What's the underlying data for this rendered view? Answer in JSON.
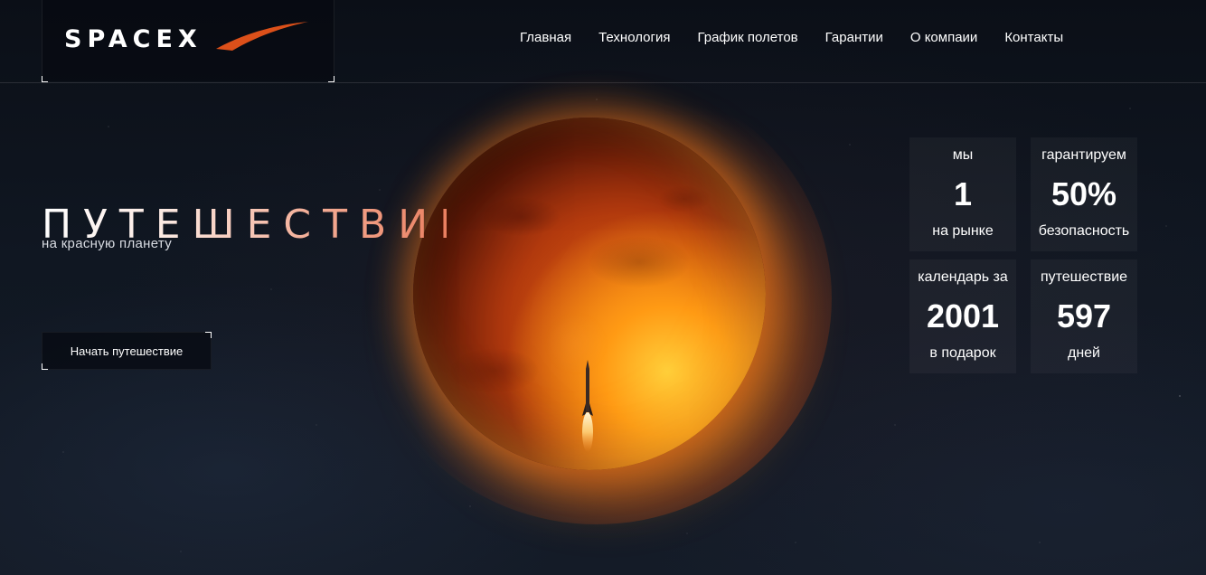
{
  "brand": {
    "logo_text": "SPACEX",
    "accent_color": "#e8541a"
  },
  "nav": {
    "items": [
      {
        "label": "Главная"
      },
      {
        "label": "Технология"
      },
      {
        "label": "График полетов"
      },
      {
        "label": "Гарантии"
      },
      {
        "label": "О компаии"
      },
      {
        "label": "Контакты"
      }
    ]
  },
  "hero": {
    "title": "ПУТЕШЕСТВИЕ",
    "subtitle": "на красную планету",
    "cta_label": "Начать путешествие"
  },
  "stats": [
    {
      "top": "мы",
      "value": "1",
      "bottom": "на рынке"
    },
    {
      "top": "гарантируем",
      "value": "50%",
      "bottom": "безопасность"
    },
    {
      "top": "календарь за",
      "value": "2001",
      "bottom": "в подарок"
    },
    {
      "top": "путешествие",
      "value": "597",
      "bottom": "дней"
    }
  ],
  "icons": {
    "planet": "mars-planet-image",
    "rocket": "rocket-image"
  }
}
